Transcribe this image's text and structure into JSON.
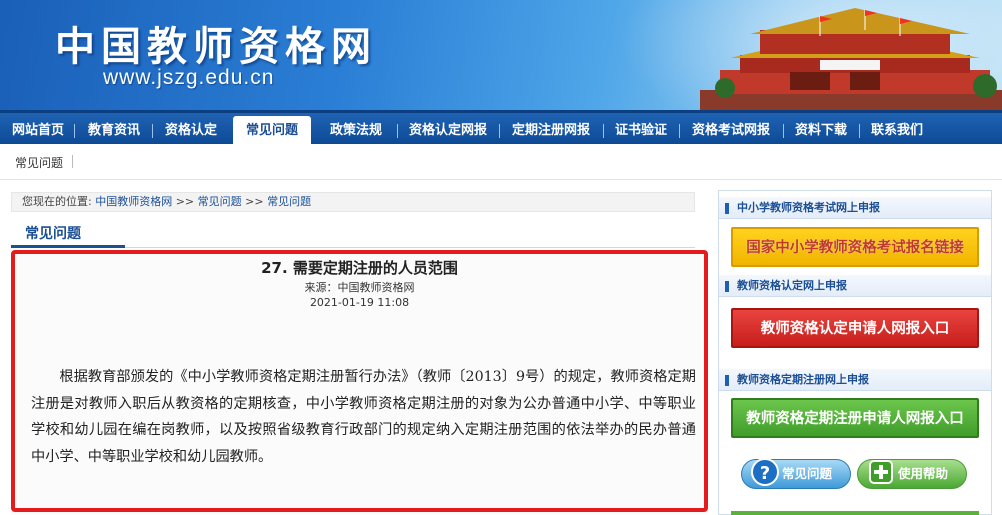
{
  "header": {
    "site_title": "中国教师资格网",
    "site_url": "www.jszg.edu.cn"
  },
  "nav": {
    "items": [
      {
        "label": "网站首页"
      },
      {
        "label": "教育资讯"
      },
      {
        "label": "资格认定"
      },
      {
        "label": "常见问题",
        "active": true
      },
      {
        "label": "政策法规"
      },
      {
        "label": "资格认定网报"
      },
      {
        "label": "定期注册网报"
      },
      {
        "label": "证书验证"
      },
      {
        "label": "资格考试网报"
      },
      {
        "label": "资料下载"
      },
      {
        "label": "联系我们"
      }
    ]
  },
  "subnav": {
    "link": "常见问题"
  },
  "breadcrumb": {
    "prefix": "您现在的位置:",
    "crumbs": [
      "中国教师资格网",
      "常见问题",
      "常见问题"
    ],
    "separator": ">>"
  },
  "section": {
    "tab_label": "常见问题"
  },
  "article": {
    "title": "27. 需要定期注册的人员范围",
    "source": "来源：中国教师资格网",
    "date": "2021-01-19 11:08",
    "body": "根据教育部颁发的《中小学教师资格定期注册暂行办法》（教师〔2013〕9号）的规定，教师资格定期注册是对教师入职后从教资格的定期核查，中小学教师资格定期注册的对象为公办普通中小学、中等职业学校和幼儿园在编在岗教师，以及按照省级教育行政部门的规定纳入定期注册范围的依法举办的民办普通中小学、中等职业学校和幼儿园教师。"
  },
  "sidebar": {
    "sections": [
      {
        "heading": "中小学教师资格考试网上申报",
        "button": "国家中小学教师资格考试报名链接"
      },
      {
        "heading": "教师资格认定网上申报",
        "button": "教师资格认定申请人网报入口"
      },
      {
        "heading": "教师资格定期注册网上申报",
        "button": "教师资格定期注册申请人网报入口"
      }
    ],
    "faq_button": "常见问题",
    "help_button": "使用帮助"
  },
  "colors": {
    "nav_bg": "#0d4a96",
    "highlight_border": "#e31d1d",
    "btn_yellow": "#f0b400",
    "btn_red": "#c81f1c",
    "btn_green": "#3f9d2a"
  }
}
